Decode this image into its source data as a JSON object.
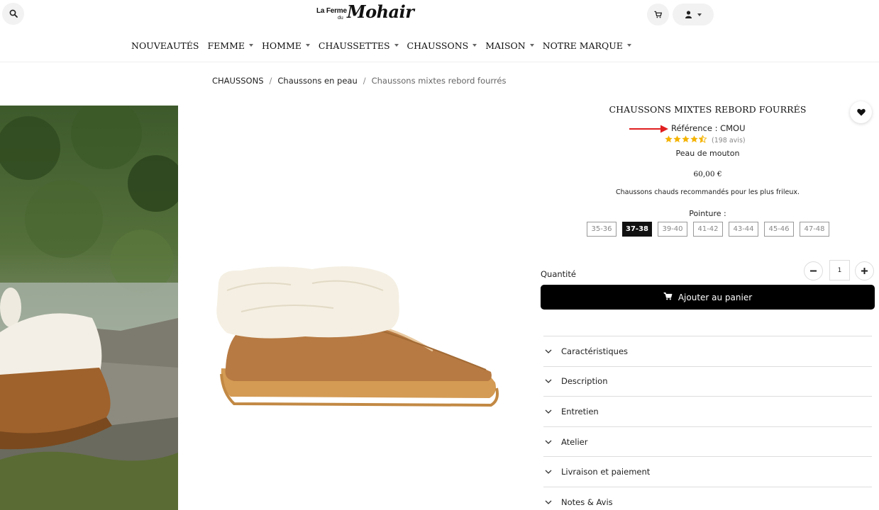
{
  "header": {
    "logo": {
      "line1": "La Ferme",
      "line2": "du",
      "script": "Mohair"
    },
    "icons": {
      "search": "search-icon",
      "cart": "cart-icon",
      "account": "user-icon"
    }
  },
  "nav": [
    {
      "label": "NOUVEAUTÉS",
      "dropdown": false
    },
    {
      "label": "FEMME",
      "dropdown": true
    },
    {
      "label": "HOMME",
      "dropdown": true
    },
    {
      "label": "CHAUSSETTES",
      "dropdown": true
    },
    {
      "label": "CHAUSSONS",
      "dropdown": true
    },
    {
      "label": "MAISON",
      "dropdown": true
    },
    {
      "label": "NOTRE MARQUE",
      "dropdown": true
    }
  ],
  "breadcrumb": {
    "items": [
      "CHAUSSONS",
      "Chaussons en peau"
    ],
    "current": "Chaussons mixtes rebord fourrés"
  },
  "product": {
    "title": "CHAUSSONS MIXTES REBORD FOURRÉS",
    "reference": "Référence : CMOU",
    "rating_stars": 4.5,
    "reviews": "(198 avis)",
    "material": "Peau de mouton",
    "price": "60,00 €",
    "short_description": "Chaussons chauds recommandés pour les plus frileux.",
    "size_label": "Pointure :",
    "sizes": [
      "35-36",
      "37-38",
      "39-40",
      "41-42",
      "43-44",
      "45-46",
      "47-48"
    ],
    "selected_size": "37-38",
    "quantity_label": "Quantité",
    "quantity": "1",
    "add_to_cart": "Ajouter au panier"
  },
  "accordion": [
    "Caractéristiques",
    "Description",
    "Entretien",
    "Atelier",
    "Livraison et paiement",
    "Notes & Avis"
  ],
  "colors": {
    "star": "#f5b301",
    "arrow": "#e02020",
    "button": "#000000"
  }
}
